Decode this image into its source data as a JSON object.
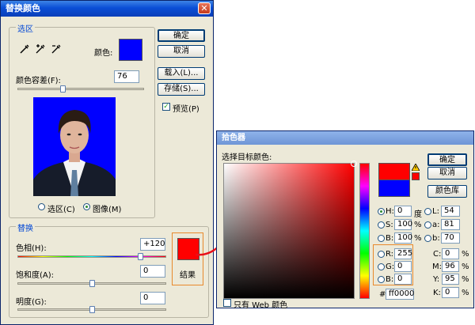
{
  "replace_dialog": {
    "title": "替换颜色",
    "selection_group": "选区",
    "color_label": "颜色:",
    "selection_color": "#0000ff",
    "tolerance_label": "颜色容差(F):",
    "tolerance_value": "76",
    "radio_selection": "选区(C)",
    "radio_image": "图像(M)",
    "buttons": {
      "ok": "确定",
      "cancel": "取消",
      "load": "载入(L)...",
      "save": "存储(S)..."
    },
    "preview_label": "预览(P)",
    "replace_group": "替换",
    "hue_label": "色相(H):",
    "hue_value": "+120",
    "saturation_label": "饱和度(A):",
    "saturation_value": "0",
    "lightness_label": "明度(G):",
    "lightness_value": "0",
    "result_label": "结果",
    "result_color": "#ff0000"
  },
  "picker_dialog": {
    "title": "拾色器",
    "prompt": "选择目标颜色:",
    "buttons": {
      "ok": "确定",
      "cancel": "取消",
      "library": "颜色库"
    },
    "web_only_label": "只有 Web 颜色",
    "fields": {
      "H": "0",
      "S": "100",
      "B": "100",
      "R": "255",
      "G": "0",
      "Bl": "0",
      "L": "54",
      "a": "81",
      "b": "70",
      "C": "0",
      "M": "96",
      "Y": "95",
      "K": "0"
    },
    "labels": {
      "H": "H:",
      "S": "S:",
      "B": "B:",
      "R": "R:",
      "G": "G:",
      "Bl": "B:",
      "L": "L:",
      "a": "a:",
      "b": "b:",
      "C": "C:",
      "M": "M:",
      "Y": "Y:",
      "K": "K:",
      "deg": "度",
      "pct": "%",
      "hash": "#"
    },
    "hex": "ff0000"
  }
}
